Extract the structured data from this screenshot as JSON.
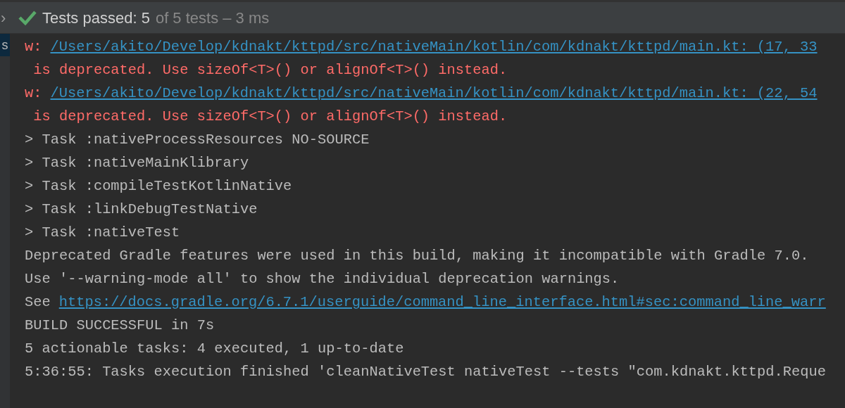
{
  "header": {
    "chevron": "›",
    "status": "Tests passed:",
    "passed": "5",
    "summary": "of 5 tests – 3 ms"
  },
  "gutter": {
    "label": "s",
    "selected": true
  },
  "lines": [
    {
      "kind": "warning",
      "prefix": "w:",
      "link": "/Users/akito/Develop/kdnakt/kttpd/src/nativeMain/kotlin/com/kdnakt/kttpd/main.kt: (17, 33"
    },
    {
      "kind": "error",
      "text": " is deprecated. Use sizeOf<T>() or alignOf<T>() instead."
    },
    {
      "kind": "warning",
      "prefix": "w:",
      "link": "/Users/akito/Develop/kdnakt/kttpd/src/nativeMain/kotlin/com/kdnakt/kttpd/main.kt: (22, 54"
    },
    {
      "kind": "error",
      "text": " is deprecated. Use sizeOf<T>() or alignOf<T>() instead."
    },
    {
      "kind": "plain",
      "text": "> Task :nativeProcessResources NO-SOURCE"
    },
    {
      "kind": "plain",
      "text": "> Task :nativeMainKlibrary"
    },
    {
      "kind": "plain",
      "text": "> Task :compileTestKotlinNative"
    },
    {
      "kind": "plain",
      "text": "> Task :linkDebugTestNative"
    },
    {
      "kind": "plain",
      "text": "> Task :nativeTest"
    },
    {
      "kind": "plain",
      "text": "Deprecated Gradle features were used in this build, making it incompatible with Gradle 7.0."
    },
    {
      "kind": "plain",
      "text": "Use '--warning-mode all' to show the individual deprecation warnings."
    },
    {
      "kind": "see",
      "prefix": "See",
      "link": "https://docs.gradle.org/6.7.1/userguide/command_line_interface.html#sec:command_line_warr"
    },
    {
      "kind": "plain",
      "text": "BUILD SUCCESSFUL in 7s"
    },
    {
      "kind": "plain",
      "text": "5 actionable tasks: 4 executed, 1 up-to-date"
    },
    {
      "kind": "plain",
      "text": "5:36:55: Tasks execution finished 'cleanNativeTest nativeTest --tests \"com.kdnakt.kttpd.Reque"
    }
  ]
}
